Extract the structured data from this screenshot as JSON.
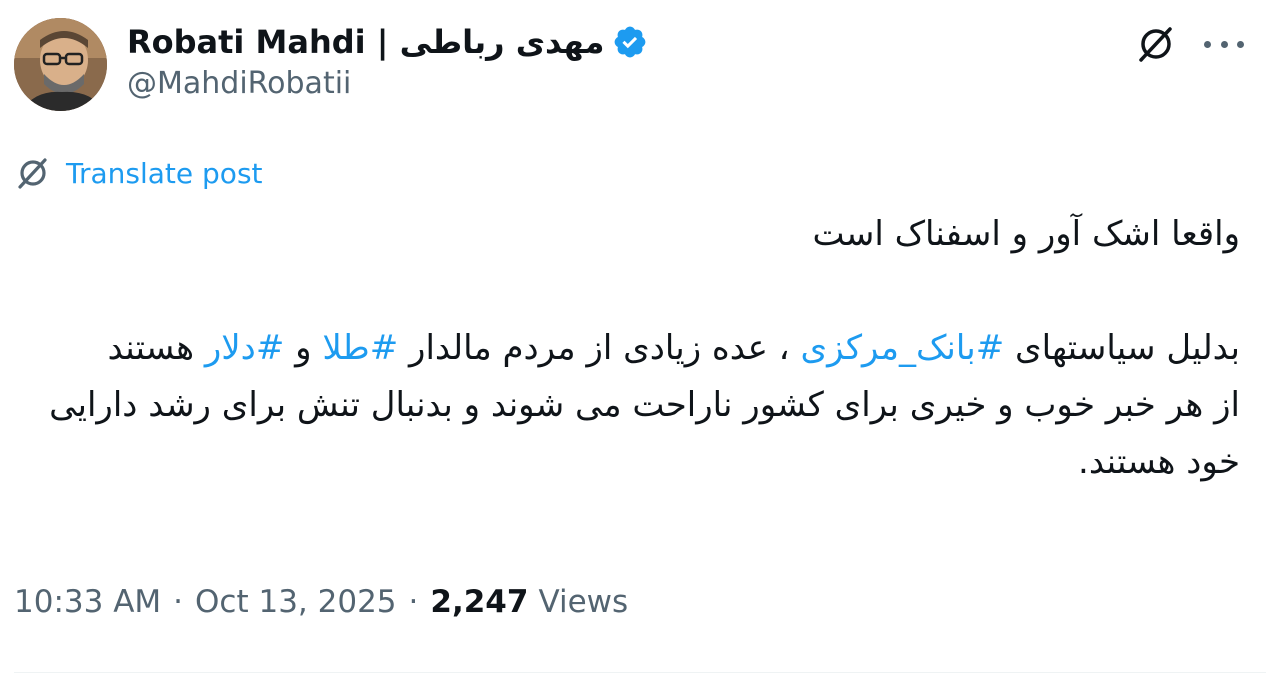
{
  "author": {
    "display_name": "Robati Mahdi | مهدی رباطی",
    "handle": "@MahdiRobatii",
    "verified": true,
    "verified_color": "#1d9bf0"
  },
  "header": {
    "grok_icon": "grok-slash-icon",
    "more_icon": "more-horizontal-icon"
  },
  "translate": {
    "icon": "grok-slash-icon",
    "label": "Translate post"
  },
  "post": {
    "line1": "واقعا اشک آور و اسفناک است",
    "para2": {
      "seg1": "بدلیل سیاستهای ",
      "tag1": "#بانک_مرکزی",
      "seg2": " ، عده زیادی از مردم مالدار ",
      "tag2": "#طلا",
      "seg3": " و ",
      "tag3": "#دلار",
      "seg4": " هستند"
    },
    "para3": "از هر خبر خوب و خیری برای کشور ناراحت می شوند و بدنبال تنش برای رشد دارایی خود هستند."
  },
  "meta": {
    "time": "10:33 AM",
    "separator": "·",
    "date": "Oct 13, 2025",
    "views_count": "2,247",
    "views_label": "Views"
  },
  "colors": {
    "accent": "#1d9bf0",
    "text": "#0f1419",
    "secondary": "#536471"
  }
}
